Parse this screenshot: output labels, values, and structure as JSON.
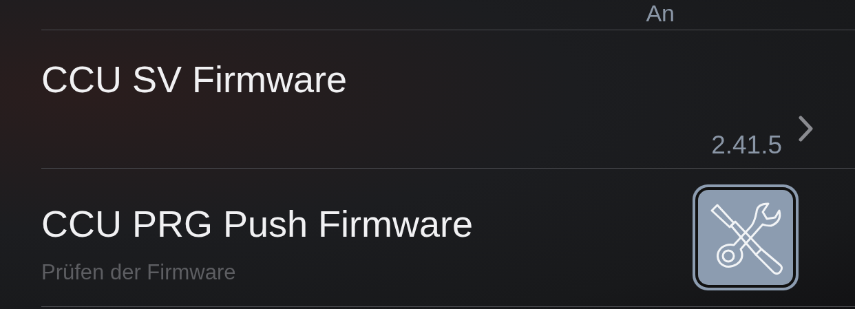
{
  "rows": [
    {
      "kind": "value",
      "value": "An",
      "chevron": false
    },
    {
      "kind": "value",
      "title": "CCU SV Firmware",
      "value": "2.41.5",
      "chevron": true
    },
    {
      "kind": "icon",
      "title": "CCU PRG Push Firmware",
      "subtitle": "Prüfen der Firmware"
    }
  ]
}
